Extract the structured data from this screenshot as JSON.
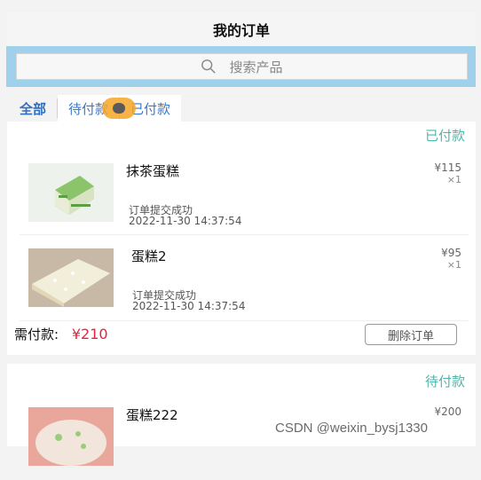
{
  "header": {
    "title": "我的订单"
  },
  "search": {
    "placeholder": "搜索产品",
    "icon": "search-icon"
  },
  "tabs": [
    {
      "label": "全部",
      "active": true
    },
    {
      "label": "待付款",
      "active": false
    },
    {
      "label": "已付款",
      "active": false
    }
  ],
  "orders": [
    {
      "status": "已付款",
      "items": [
        {
          "name": "抹茶蛋糕",
          "price": "¥115",
          "qty": "×1",
          "state": "订单提交成功",
          "time": "2022-11-30 14:37:54"
        },
        {
          "name": "蛋糕2",
          "price": "¥95",
          "qty": "×1",
          "state": "订单提交成功",
          "time": "2022-11-30 14:37:54"
        }
      ],
      "total_label": "需付款:",
      "total_amount": "¥210",
      "delete_label": "删除订单"
    },
    {
      "status": "待付款",
      "items": [
        {
          "name": "蛋糕222",
          "price": "¥200"
        }
      ]
    }
  ],
  "watermark": "CSDN @weixin_bysj1330",
  "colors": {
    "accent": "#4fb6a9",
    "price_red": "#e8233f",
    "tab_blue": "#2f6fc0",
    "search_bg": "#9fd1ec"
  }
}
